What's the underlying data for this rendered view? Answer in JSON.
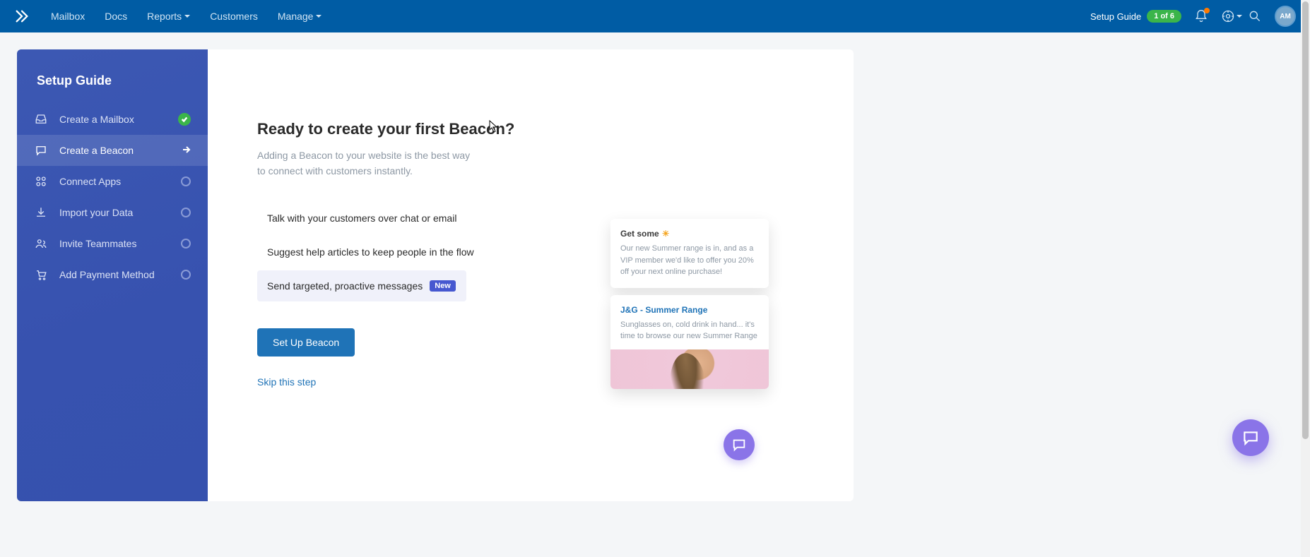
{
  "topnav": {
    "links": [
      "Mailbox",
      "Docs",
      "Reports",
      "Customers",
      "Manage"
    ],
    "setup_guide_label": "Setup Guide",
    "setup_guide_badge": "1 of 6",
    "avatar_initials": "AM"
  },
  "sidebar": {
    "title": "Setup Guide",
    "items": [
      {
        "label": "Create a Mailbox",
        "status": "done"
      },
      {
        "label": "Create a Beacon",
        "status": "active"
      },
      {
        "label": "Connect Apps",
        "status": "todo"
      },
      {
        "label": "Import your Data",
        "status": "todo"
      },
      {
        "label": "Invite Teammates",
        "status": "todo"
      },
      {
        "label": "Add Payment Method",
        "status": "todo"
      }
    ]
  },
  "main": {
    "heading": "Ready to create your first Beacon?",
    "subtitle": "Adding a Beacon to your website is the best way to connect with customers instantly.",
    "features": [
      "Talk with your customers over chat or email",
      "Suggest help articles to keep people in the flow",
      "Send targeted, proactive messages"
    ],
    "new_badge": "New",
    "cta_label": "Set Up Beacon",
    "skip_label": "Skip this step"
  },
  "preview": {
    "card1_title": "Get some ",
    "card1_emoji": "☀",
    "card1_body": "Our new Summer range is in, and as a VIP member we'd like to offer you 20% off your next online purchase!",
    "card2_title": "J&G - Summer Range",
    "card2_body": "Sunglasses on, cold drink in hand... it's time to browse our new Summer Range"
  }
}
